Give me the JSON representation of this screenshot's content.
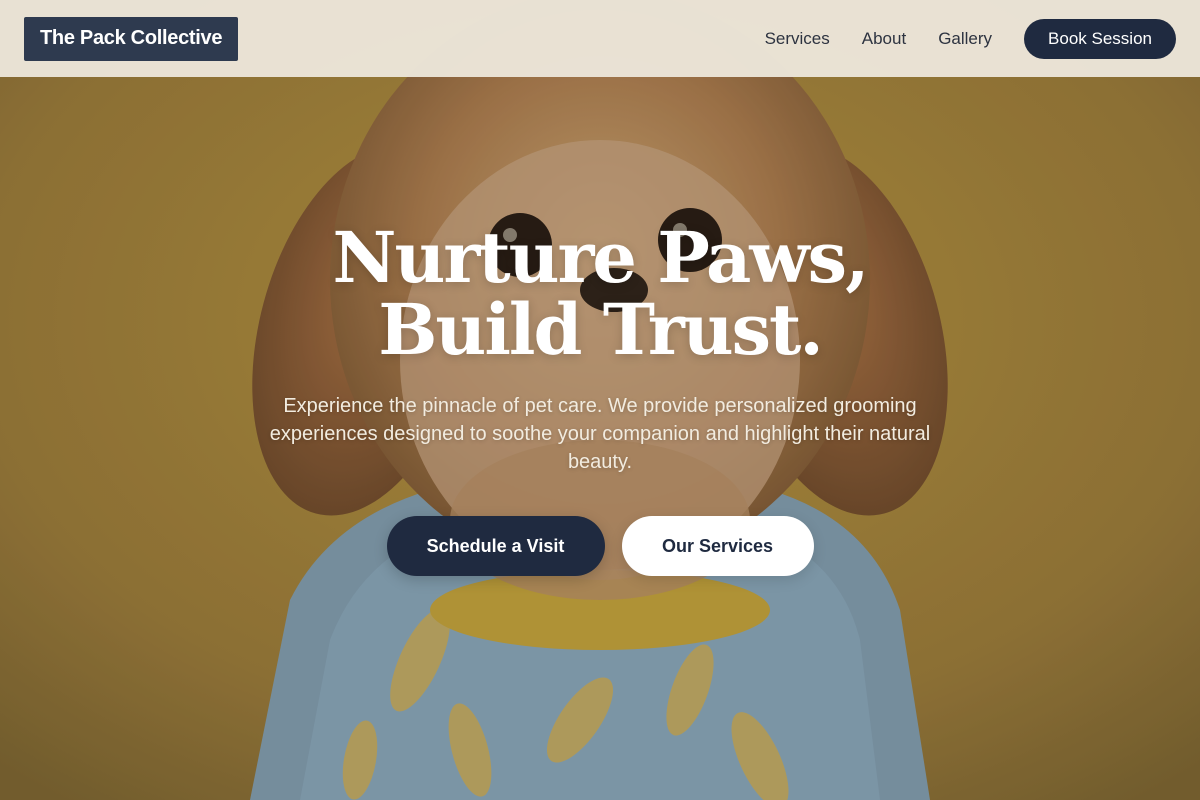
{
  "brand": {
    "name": "The Pack Collective"
  },
  "nav": {
    "items": [
      {
        "label": "Services"
      },
      {
        "label": "About"
      },
      {
        "label": "Gallery"
      }
    ],
    "cta_label": "Book Session"
  },
  "hero": {
    "headline_line1": "Nurture Paws,",
    "headline_line2": "Build Trust.",
    "subtext": "Experience the pinnacle of pet care. We provide personalized grooming experiences designed to soothe your companion and highlight their natural beauty.",
    "primary_cta": "Schedule a Visit",
    "secondary_cta": "Our Services",
    "image_subject": "small fluffy dog in a blue banana-print shirt on a mustard-yellow background"
  },
  "colors": {
    "header_bg": "#ECE6DA",
    "brand_bg": "#2E3A4F",
    "primary": "#1F2A40",
    "background": "#9A7F3A",
    "text_light": "#FFFFFF"
  }
}
